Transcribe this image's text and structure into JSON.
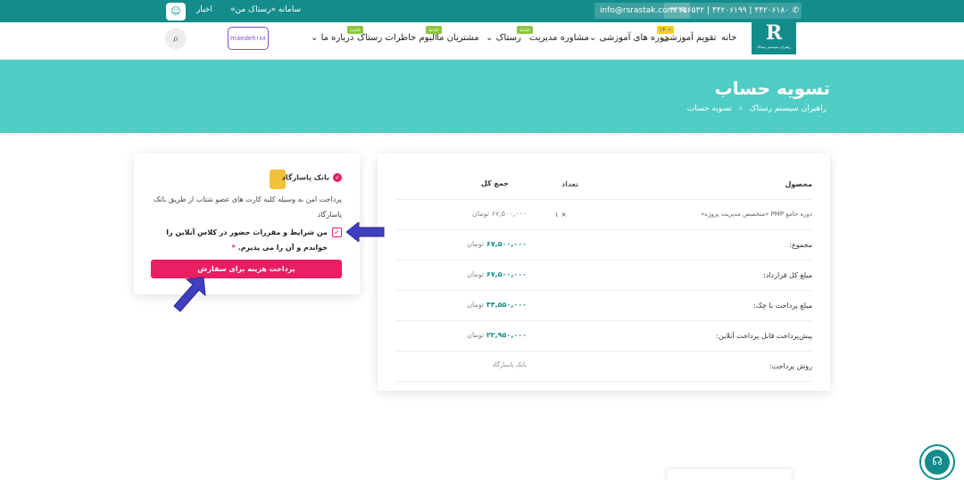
{
  "topbar": {
    "phone": "۴۴۲۰۶۱۸۰ | ۴۴۲۰۶۱۹۹ | ۴۴۲۵۶۵۳۲",
    "email": "info@rsrastak.com",
    "system_link": "سامانه «رستاک من»",
    "news_link": "اخبار"
  },
  "logo": {
    "mark": "R",
    "tagline": "راهبران سیستم رستاک"
  },
  "nav": {
    "home": "خانه",
    "calendar": "تقویم آموزشی",
    "courses": "دوره های آموزشی",
    "consulting": "مشاوره مدیریت",
    "rastak": "رستاک",
    "customers": "مشتریان ما",
    "album": "آلبوم خاطرات رستاک",
    "about": "درباره ما",
    "badge_new": "جدید",
    "badge_calendar": "۱۴۰۱",
    "username": "maedeh۱۸۸"
  },
  "hero": {
    "title": "تسویه حساب",
    "crumb_home": "راهبران سیستم رستاک",
    "crumb_sep": "›",
    "crumb_current": "تسویه حساب"
  },
  "order": {
    "headers": {
      "product": "محصول",
      "qty": "تعداد",
      "total": "جمع کل"
    },
    "item": {
      "name": "دوره جامع PMP «متخصص مدیریت پروژه»",
      "qty": "× ۱",
      "price": "۶۷,۵۰۰,۰۰۰",
      "unit": "تومان"
    },
    "subtotal": {
      "label": "مجموع:",
      "price": "۶۷,۵۰۰,۰۰۰",
      "unit": "تومان"
    },
    "contract": {
      "label": "مبلغ کل قرارداد:",
      "price": "۶۷,۵۰۰,۰۰۰",
      "unit": "تومان"
    },
    "cheque": {
      "label": "مبلغ پرداخت با چک:",
      "price": "۴۴,۵۵۰,۰۰۰",
      "unit": "تومان"
    },
    "prepay": {
      "label": "پیش‌پرداخت قابل پرداخت آنلاین:",
      "price": "۲۲,۹۵۰,۰۰۰",
      "unit": "تومان"
    },
    "method": {
      "label": "روش پرداخت:",
      "value": "بانک پاسارگاد"
    }
  },
  "payment": {
    "bank_name": "بانک پاسارگاد",
    "description": "پرداخت امن به وسیله کلیه کارت های عضو شتاب از طریق بانک پاسارگاد",
    "terms": "من شرایط و مقررات حضور در کلاس آنلاین را خواندم و آن را می پذیرم.",
    "required_mark": "*",
    "submit": "پرداخت هزینه برای سفارش"
  },
  "colors": {
    "teal": "#138c8c",
    "hero": "#4ecdc4",
    "accent": "#e91e63",
    "arrow": "#3f3fbf"
  }
}
